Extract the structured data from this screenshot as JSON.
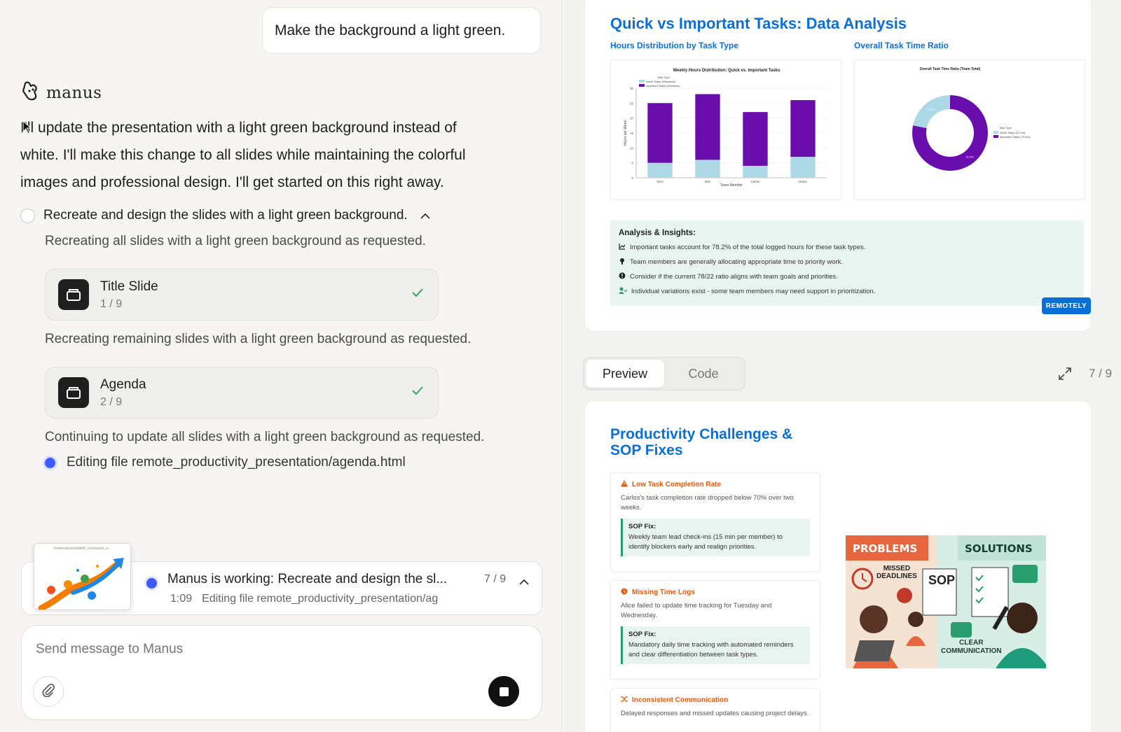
{
  "chat": {
    "user_message": "Make the background a light green.",
    "assistant_name": "manus",
    "intro_lines": [
      "I'll update the presentation with a light green background instead of",
      "white. I'll make this change to all slides while maintaining the colorful",
      "images and professional design. I'll get started on this right away."
    ],
    "step_title": "Recreate and design the slides with a light green background.",
    "sub1": "Recreating all slides with a light green background as requested.",
    "card1_title": "Title Slide",
    "card1_count": "1 / 9",
    "sub2": "Recreating remaining slides with a light green background as requested.",
    "card2_title": "Agenda",
    "card2_count": "2 / 9",
    "sub3": "Continuing to update all slides with a light green background as requested.",
    "editing_text": "Editing file remote_productivity_presentation/agenda.html"
  },
  "status_bar": {
    "thumb_path": "/home/ubuntu/slide8_conclusion_n...",
    "title": "Manus is working: Recreate and design the sl...",
    "progress": "7 / 9",
    "time": "1:09",
    "detail": "Editing file remote_productivity_presentation/ag"
  },
  "composer": {
    "placeholder": "Send message to Manus"
  },
  "slide_top": {
    "title": "Quick vs Important Tasks: Data Analysis",
    "left_heading": "Hours Distribution by Task Type",
    "right_heading": "Overall Task Time Ratio",
    "insights_title": "Analysis & Insights:",
    "insights": [
      "Important tasks account for 78.2% of the total logged hours for these task types.",
      "Team members are generally allocating appropriate time to priority work.",
      "Consider if the current 78/22 ratio aligns with team goals and priorities.",
      "Individual variations exist - some team members may need support in prioritization."
    ],
    "badge": "REMOTELY"
  },
  "chart_data": [
    {
      "type": "bar",
      "title": "Weekly Hours Distribution: Quick vs. Important Tasks",
      "xlabel": "Team Member",
      "ylabel": "Hours per Week",
      "categories": [
        "Alice",
        "Bob",
        "Carlos",
        "Diana"
      ],
      "ylim": [
        0,
        30
      ],
      "stacked": true,
      "legend_title": "Task Type",
      "series": [
        {
          "name": "Quick Tasks (Hrs/week)",
          "color": "#add8e6",
          "values": [
            5,
            6,
            4,
            7
          ]
        },
        {
          "name": "Important Tasks (Hrs/week)",
          "color": "#6a0dad",
          "values": [
            20,
            22,
            18,
            19
          ]
        }
      ]
    },
    {
      "type": "pie",
      "title": "Overall Task Time Ratio (Team Total)",
      "legend_title": "Task Type",
      "categories": [
        "Quick Tasks (22 hrs)",
        "Important Tasks (79 hrs)"
      ],
      "values": [
        21.8,
        78.2
      ],
      "labels": [
        "21.8%",
        "78.2%"
      ],
      "colors": [
        "#add8e6",
        "#6a0dad"
      ]
    }
  ],
  "tabs": {
    "preview": "Preview",
    "code": "Code",
    "page": "7 / 9"
  },
  "slide_bottom": {
    "title_line1": "Productivity Challenges &",
    "title_line2": "SOP Fixes",
    "challenges": [
      {
        "title": "Low Task Completion Rate",
        "desc": "Carlos's task completion rate dropped below 70% over two weeks.",
        "sop_label": "SOP Fix:",
        "sop_text": "Weekly team lead check-ins (15 min per member) to identify blockers early and realign priorities."
      },
      {
        "title": "Missing Time Logs",
        "desc": "Alice failed to update time tracking for Tuesday and Wednesday.",
        "sop_label": "SOP Fix:",
        "sop_text": "Mandatory daily time tracking with automated reminders and clear differentiation between task types."
      },
      {
        "title": "Inconsistent Communication",
        "desc": "Delayed responses and missed updates causing project delays."
      }
    ],
    "illustration": {
      "problems": "PROBLEMS",
      "solutions": "SOLUTIONS",
      "missed": "MISSED",
      "deadlines": "DEADLINES",
      "sop": "SOP",
      "clear": "CLEAR",
      "communication": "COMMUNICATION"
    }
  }
}
